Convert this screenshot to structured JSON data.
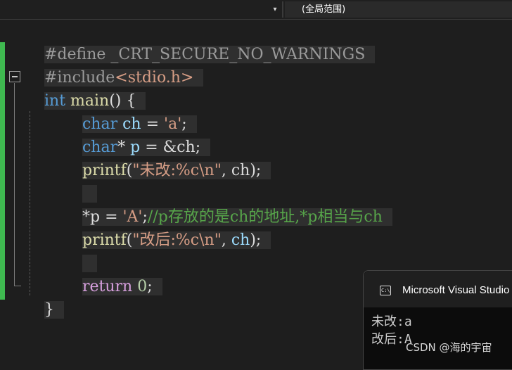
{
  "navbar": {
    "dropdown_left_caret": "▾",
    "scope_label": "(全局范围)"
  },
  "editor": {
    "line1": {
      "text": "#define _CRT_SECURE_NO_WARNINGS"
    },
    "line2": {
      "directive": "#include",
      "header": "<stdio.h>"
    },
    "line3": {
      "kw": "int",
      "fn": "main",
      "rest": "() {"
    },
    "line4": {
      "kw": "char",
      "var": "ch",
      "op": " = ",
      "str": "'a'",
      "end": ";"
    },
    "line5": {
      "kw": "char",
      "rest": "* ",
      "var": "p",
      "op": " = &",
      "var2": "ch",
      "end": ";"
    },
    "line6": {
      "fn": "printf",
      "open": "(",
      "str": "\"未改:%c\\n\"",
      "sep": ", ",
      "var": "ch",
      "end": ");"
    },
    "line8": {
      "op": "*",
      "var": "p",
      "eq": " = ",
      "str": "'A'",
      "semi": ";",
      "comment": "//p存放的是ch的地址,*p相当与ch"
    },
    "line9": {
      "fn": "printf",
      "open": "(",
      "str": "\"改后:%c\\n\"",
      "sep": ", ",
      "var": "ch",
      "end": ");"
    },
    "line11": {
      "kw": "return",
      "num": " 0",
      "end": ";"
    },
    "line12": {
      "text": "}"
    }
  },
  "console": {
    "title": "Microsoft Visual Studio",
    "icon": "console-window-icon",
    "output": "未改:a\n改后:A"
  },
  "watermark": "CSDN @海的宇宙"
}
